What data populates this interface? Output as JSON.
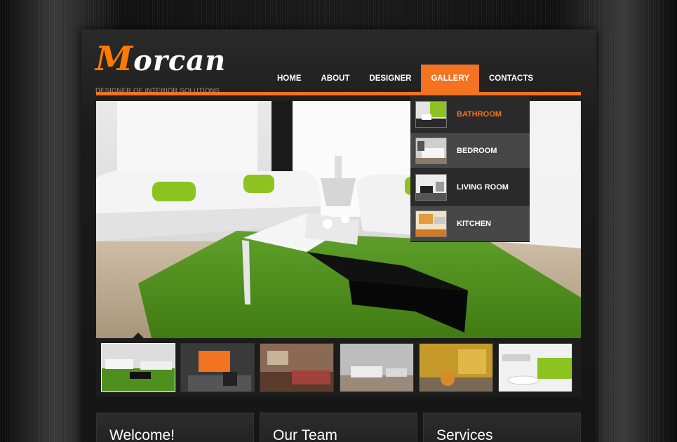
{
  "brand": {
    "logo_initial": "M",
    "logo_rest": "orcan",
    "tagline": "DESIGNER OF INTERIOR SOLUTIONS"
  },
  "nav": {
    "items": [
      {
        "label": "HOME",
        "active": false
      },
      {
        "label": "ABOUT",
        "active": false
      },
      {
        "label": "DESIGNER",
        "active": false
      },
      {
        "label": "GALLERY",
        "active": true
      },
      {
        "label": "CONTACTS",
        "active": false
      }
    ]
  },
  "gallery_menu": {
    "items": [
      {
        "label": "BATHROOM",
        "active": true
      },
      {
        "label": "BEDROOM",
        "active": false
      },
      {
        "label": "LIVING ROOM",
        "active": false
      },
      {
        "label": "KITCHEN",
        "active": false
      }
    ]
  },
  "thumbnails": {
    "count": 6,
    "selected_index": 0
  },
  "columns": {
    "welcome": "Welcome!",
    "team": "Our Team",
    "services": "Services"
  },
  "colors": {
    "accent": "#f37321",
    "background": "#151515"
  }
}
